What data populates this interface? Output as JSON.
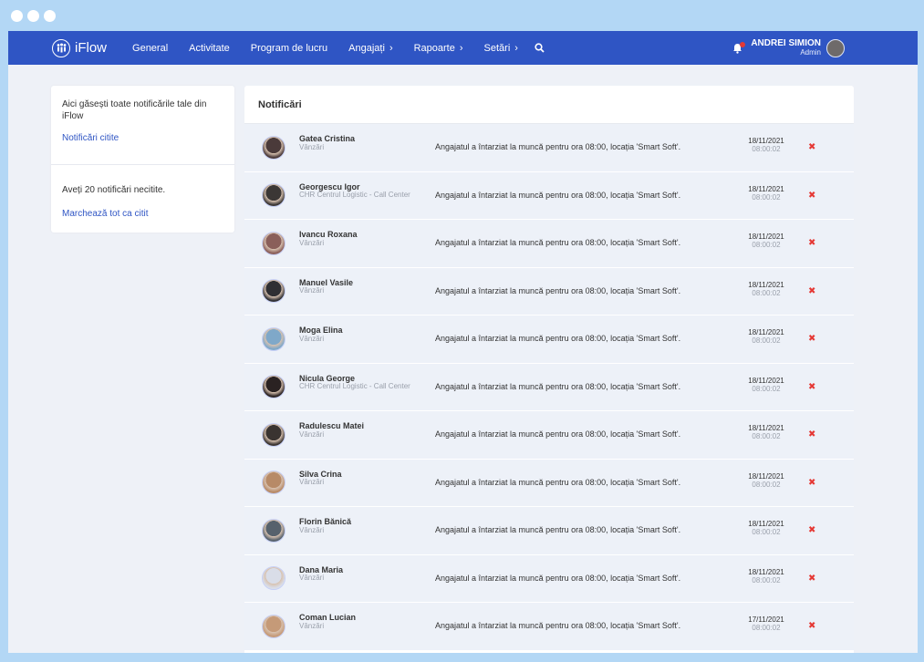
{
  "app": {
    "name": "iFlow"
  },
  "nav": {
    "items": [
      {
        "label": "General",
        "has_menu": false
      },
      {
        "label": "Activitate",
        "has_menu": false
      },
      {
        "label": "Program de lucru",
        "has_menu": false
      },
      {
        "label": "Angajați",
        "has_menu": true
      },
      {
        "label": "Rapoarte",
        "has_menu": true
      },
      {
        "label": "Setări",
        "has_menu": true
      }
    ],
    "user_name": "ANDREI SIMION",
    "user_role": "Admin"
  },
  "sidebar": {
    "intro": "Aici găsești toate notificările tale din iFlow",
    "read_link": "Notificări citite",
    "unread_text": "Aveți 20 notificări necitite.",
    "mark_all_link": "Marchează tot ca citit"
  },
  "notifications": {
    "title": "Notificări",
    "items": [
      {
        "name": "Gatea Cristina",
        "dept": "Vânzări",
        "message": "Angajatul a întarziat la muncă pentru ora 08:00, locația 'Smart Soft'.",
        "date": "18/11/2021",
        "time": "08:00:02",
        "avatar_color": "#4a3a3a"
      },
      {
        "name": "Georgescu Igor",
        "dept": "CHR Centrul Logistic - Call Center",
        "message": "Angajatul a întarziat la muncă pentru ora 08:00, locația 'Smart Soft'.",
        "date": "18/11/2021",
        "time": "08:00:02",
        "avatar_color": "#3b3735"
      },
      {
        "name": "Ivancu Roxana",
        "dept": "Vânzări",
        "message": "Angajatul a întarziat la muncă pentru ora 08:00, locația 'Smart Soft'.",
        "date": "18/11/2021",
        "time": "08:00:02",
        "avatar_color": "#8a5f5a"
      },
      {
        "name": "Manuel Vasile",
        "dept": "Vânzări",
        "message": "Angajatul a întarziat la muncă pentru ora 08:00, locația 'Smart Soft'.",
        "date": "18/11/2021",
        "time": "08:00:02",
        "avatar_color": "#2f2f33"
      },
      {
        "name": "Moga Elina",
        "dept": "Vânzări",
        "message": "Angajatul a întarziat la muncă pentru ora 08:00, locația 'Smart Soft'.",
        "date": "18/11/2021",
        "time": "08:00:02",
        "avatar_color": "#7fa8c9"
      },
      {
        "name": "Nicula George",
        "dept": "CHR Centrul Logistic - Call Center",
        "message": "Angajatul a întarziat la muncă pentru ora 08:00, locația 'Smart Soft'.",
        "date": "18/11/2021",
        "time": "08:00:02",
        "avatar_color": "#2a2222"
      },
      {
        "name": "Radulescu Matei",
        "dept": "Vânzări",
        "message": "Angajatul a întarziat la muncă pentru ora 08:00, locația 'Smart Soft'.",
        "date": "18/11/2021",
        "time": "08:00:02",
        "avatar_color": "#3a3431"
      },
      {
        "name": "Silva Crina",
        "dept": "Vânzări",
        "message": "Angajatul a întarziat la muncă pentru ora 08:00, locația 'Smart Soft'.",
        "date": "18/11/2021",
        "time": "08:00:02",
        "avatar_color": "#b78a67"
      },
      {
        "name": "Florin Bănică",
        "dept": "Vânzări",
        "message": "Angajatul a întarziat la muncă pentru ora 08:00, locația 'Smart Soft'.",
        "date": "18/11/2021",
        "time": "08:00:02",
        "avatar_color": "#56616c"
      },
      {
        "name": "Dana Maria",
        "dept": "Vânzări",
        "message": "Angajatul a întarziat la muncă pentru ora 08:00, locația 'Smart Soft'.",
        "date": "18/11/2021",
        "time": "08:00:02",
        "avatar_color": "#d9dde8"
      },
      {
        "name": "Coman Lucian",
        "dept": "Vânzări",
        "message": "Angajatul a întarziat la muncă pentru ora 08:00, locația 'Smart Soft'.",
        "date": "17/11/2021",
        "time": "08:00:02",
        "avatar_color": "#c59a78"
      }
    ]
  },
  "colors": {
    "brand": "#2f55c4",
    "delete": "#e53935",
    "row_bg": "#edf1f8"
  },
  "icons": {
    "search": "search-icon",
    "bell": "bell-icon",
    "delete": "close-icon"
  }
}
